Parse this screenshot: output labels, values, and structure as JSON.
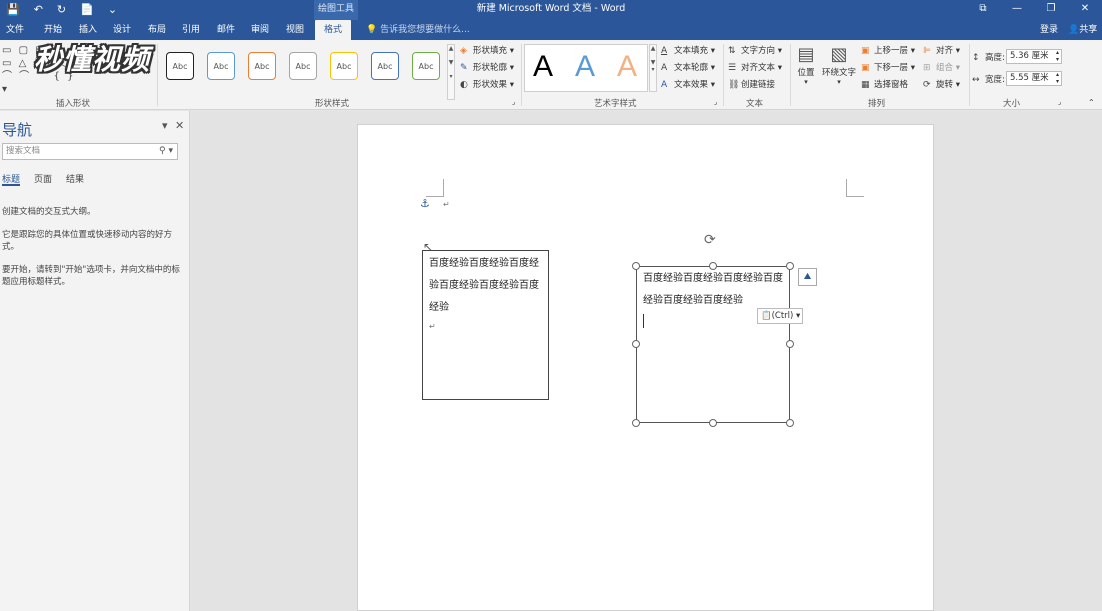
{
  "titlebar": {
    "qat": [
      "💾",
      "↶",
      "↻",
      "📄",
      "⌄"
    ],
    "drawing_tools": "绘图工具",
    "title": "新建 Microsoft Word 文档 - Word",
    "window_controls": [
      "⧉",
      "—",
      "❐",
      "✕"
    ]
  },
  "tabs": {
    "file": "文件",
    "home": "开始",
    "insert": "插入",
    "design": "设计",
    "layout": "布局",
    "references": "引用",
    "mailings": "邮件",
    "review": "审阅",
    "view": "视图",
    "format": "格式",
    "tellme": "告诉我您想要做什么...",
    "login": "登录",
    "share": "共享"
  },
  "ribbon": {
    "insert_shapes": {
      "label": "插入形状",
      "shapes_row1": "▭ ▢ ▤ ⌐ ▾",
      "shapes_row2": "▭ △ ∖ ∖ ⬡ ▾",
      "shapes_row3": "⌒ ⌒ ⌒ { } ▾"
    },
    "shape_styles": {
      "label": "形状样式",
      "styles": [
        "Abc",
        "Abc",
        "Abc",
        "Abc",
        "Abc",
        "Abc",
        "Abc"
      ],
      "colors": [
        "#222222",
        "#5b9bd5",
        "#ed7d31",
        "#a5a5a5",
        "#ffc000",
        "#4472c4",
        "#70ad47"
      ],
      "fill": "形状填充",
      "outline": "形状轮廓",
      "effects": "形状效果"
    },
    "wordart": {
      "label": "艺术字样式",
      "letters": [
        "A",
        "A",
        "A"
      ],
      "colors": [
        "#000000",
        "#5b9bd5",
        "#f4b183"
      ],
      "text_fill": "文本填充",
      "text_outline": "文本轮廓",
      "text_effects": "文本效果"
    },
    "text": {
      "label": "文本",
      "direction": "文字方向",
      "align": "对齐文本",
      "link": "创建链接"
    },
    "arrange": {
      "label": "排列",
      "position": "位置",
      "wrap": "环绕文字",
      "bring_forward": "上移一层",
      "send_backward": "下移一层",
      "selection_pane": "选择窗格",
      "align": "对齐",
      "group": "组合",
      "rotate": "旋转"
    },
    "size": {
      "label": "大小",
      "height_label": "高度:",
      "height_value": "5.36 厘米",
      "width_label": "宽度:",
      "width_value": "5.55 厘米"
    }
  },
  "watermark": "秒懂视频",
  "navigation": {
    "title": "导航",
    "search_placeholder": "搜索文档",
    "tabs": [
      "标题",
      "页面",
      "结果"
    ],
    "text1": "创建文档的交互式大纲。",
    "text2": "它是跟踪您的具体位置或快速移动内容的好方式。",
    "text3": "要开始，请转到\"开始\"选项卡，并向文档中的标题应用标题样式。"
  },
  "document": {
    "textbox1": "百度经验百度经验百度经验百度经验百度经验百度经验",
    "textbox2": "百度经验百度经验百度经验百度经验百度经验百度经验",
    "paste_options": "(Ctrl)"
  }
}
